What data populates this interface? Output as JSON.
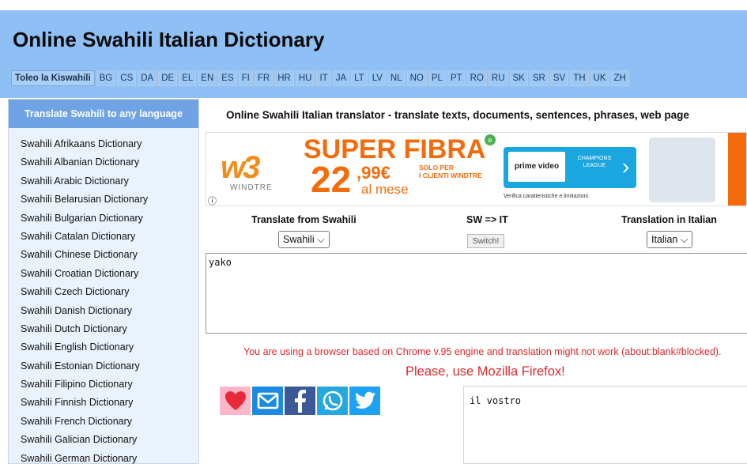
{
  "header": {
    "title": "Online Swahili Italian Dictionary",
    "languages": [
      {
        "code": "Toleo la Kiswahili",
        "active": true
      },
      {
        "code": "BG"
      },
      {
        "code": "CS"
      },
      {
        "code": "DA"
      },
      {
        "code": "DE"
      },
      {
        "code": "EL"
      },
      {
        "code": "EN"
      },
      {
        "code": "ES"
      },
      {
        "code": "FI"
      },
      {
        "code": "FR"
      },
      {
        "code": "HR"
      },
      {
        "code": "HU"
      },
      {
        "code": "IT"
      },
      {
        "code": "JA"
      },
      {
        "code": "LT"
      },
      {
        "code": "LV"
      },
      {
        "code": "NL"
      },
      {
        "code": "NO"
      },
      {
        "code": "PL"
      },
      {
        "code": "PT"
      },
      {
        "code": "RO"
      },
      {
        "code": "RU"
      },
      {
        "code": "SK"
      },
      {
        "code": "SR"
      },
      {
        "code": "SV"
      },
      {
        "code": "TH"
      },
      {
        "code": "UK"
      },
      {
        "code": "ZH"
      }
    ]
  },
  "sidebar": {
    "heading": "Translate Swahili to any language",
    "items": [
      "Swahili Afrikaans Dictionary",
      "Swahili Albanian Dictionary",
      "Swahili Arabic Dictionary",
      "Swahili Belarusian Dictionary",
      "Swahili Bulgarian Dictionary",
      "Swahili Catalan Dictionary",
      "Swahili Chinese Dictionary",
      "Swahili Croatian Dictionary",
      "Swahili Czech Dictionary",
      "Swahili Danish Dictionary",
      "Swahili Dutch Dictionary",
      "Swahili English Dictionary",
      "Swahili Estonian Dictionary",
      "Swahili Filipino Dictionary",
      "Swahili Finnish Dictionary",
      "Swahili French Dictionary",
      "Swahili Galician Dictionary",
      "Swahili German Dictionary"
    ]
  },
  "main": {
    "title": "Online Swahili Italian translator - translate texts, documents, sentences, phrases, web page"
  },
  "ad": {
    "brand_logo": "w3",
    "brand_name": "WINDTRE",
    "headline": "SUPER FIBRA",
    "badge": "e",
    "price_int": "22",
    "price_dec": ",99€",
    "per_month": "al mese",
    "solo_line1": "SOLO PER",
    "solo_line2": "I CLIENTI WINDTRE",
    "prime": "prime video",
    "champions": "CHAMPIONS LEAGUE",
    "verifica": "Verifica caratteristiche e limitazioni.",
    "info": "ⓘ"
  },
  "translator": {
    "from_label": "Translate from Swahili",
    "direction_label": "SW => IT",
    "to_label": "Translation in Italian",
    "from_select": "Swahili ⌵",
    "to_select": "Italian ⌵",
    "switch_label": "Switch!",
    "source_text": "yako",
    "output_text": "il vostro"
  },
  "warning": {
    "line1": "You are using a browser based on Chrome v.95 engine and translation might not work (about:blank#blocked).",
    "line2": "Please, use Mozilla Firefox!"
  },
  "social": [
    {
      "icon": "heart-icon",
      "color": "#e8293a"
    },
    {
      "icon": "mail-icon",
      "color": "#ffffff"
    },
    {
      "icon": "facebook-icon",
      "color": "#ffffff"
    },
    {
      "icon": "whatsapp-icon",
      "color": "#ffffff"
    },
    {
      "icon": "twitter-icon",
      "color": "#ffffff"
    }
  ]
}
